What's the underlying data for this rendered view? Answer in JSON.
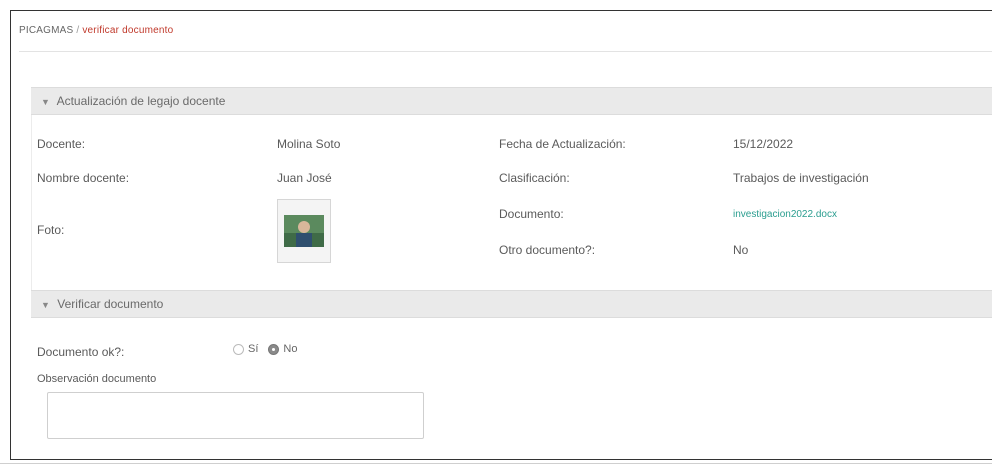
{
  "breadcrumb": {
    "root": "PICAGMAS",
    "separator": "/",
    "current": "verificar documento"
  },
  "panel1": {
    "title": "Actualización de legajo docente",
    "fields": {
      "docente_label": "Docente:",
      "docente_value": "Molina Soto",
      "nombre_label": "Nombre docente:",
      "nombre_value": "Juan José",
      "foto_label": "Foto:",
      "fecha_label": "Fecha de Actualización:",
      "fecha_value": "15/12/2022",
      "clasificacion_label": "Clasificación:",
      "clasificacion_value": "Trabajos de investigación",
      "documento_label": "Documento:",
      "documento_value": "investigacion2022.docx",
      "otro_label": "Otro documento?:",
      "otro_value": "No"
    }
  },
  "panel2": {
    "title": "Verificar documento",
    "doc_ok_label": "Documento ok?:",
    "option_si": "Sí",
    "option_no": "No",
    "selected": "No",
    "obs_label": "Observación documento",
    "obs_value": ""
  },
  "colors": {
    "accent_link": "#2a9d8f",
    "breadcrumb_current": "#c0392b",
    "panel_header": "#eaeaea"
  }
}
